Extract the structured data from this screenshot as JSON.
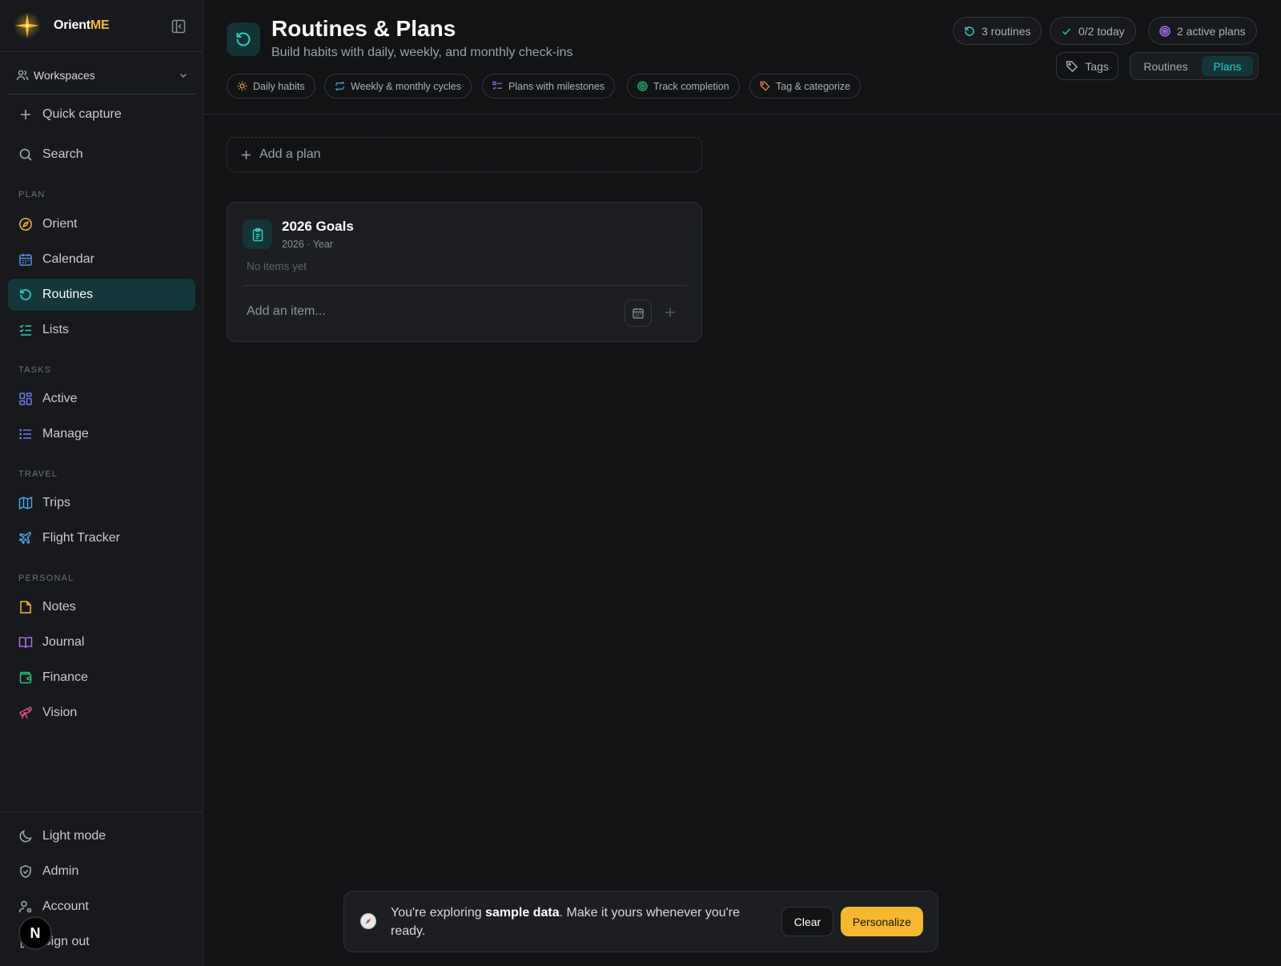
{
  "app": {
    "brand_prefix": "Orient",
    "brand_suffix": "ME"
  },
  "sidebar": {
    "workspaces_label": "Workspaces",
    "quick_capture": "Quick capture",
    "search": "Search",
    "sections": {
      "plan": "PLAN",
      "tasks": "TASKS",
      "travel": "TRAVEL",
      "personal": "PERSONAL"
    },
    "items": {
      "orient": "Orient",
      "calendar": "Calendar",
      "routines": "Routines",
      "lists": "Lists",
      "active": "Active",
      "manage": "Manage",
      "trips": "Trips",
      "flight_tracker": "Flight Tracker",
      "notes": "Notes",
      "journal": "Journal",
      "finance": "Finance",
      "vision": "Vision"
    },
    "bottom": {
      "light_mode": "Light mode",
      "admin": "Admin",
      "account": "Account",
      "sign_out": "Sign out"
    },
    "avatar_letter": "N",
    "active_item": "routines"
  },
  "header": {
    "title": "Routines & Plans",
    "subtitle": "Build habits with daily, weekly, and monthly check-ins",
    "chips": [
      "Daily habits",
      "Weekly & monthly cycles",
      "Plans with milestones",
      "Track completion",
      "Tag & categorize"
    ],
    "stats": {
      "routines": "3 routines",
      "today": "0/2 today",
      "plans": "2 active plans"
    },
    "tags_label": "Tags",
    "view_toggle": {
      "routines": "Routines",
      "plans": "Plans",
      "selected": "Plans"
    }
  },
  "main": {
    "add_plan_label": "Add a plan",
    "plans": [
      {
        "title": "2026 Goals",
        "meta": "2026 · Year",
        "empty_text": "No items yet",
        "add_item_placeholder": "Add an item..."
      }
    ]
  },
  "toast": {
    "msg_before": "You're exploring ",
    "msg_bold": "sample data",
    "msg_after": ". Make it yours whenever you're ready.",
    "clear_label": "Clear",
    "personalize_label": "Personalize"
  },
  "colors": {
    "accent_teal": "#2bcfc0",
    "brand_yellow": "#f5b82e",
    "background": "#111315",
    "sidebar_bg": "#17191c"
  }
}
